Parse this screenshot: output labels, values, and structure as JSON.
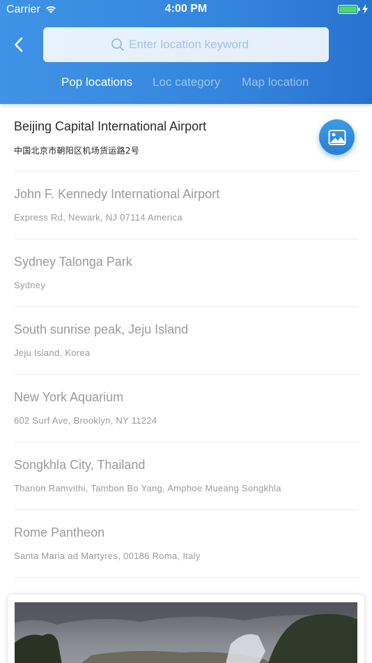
{
  "status_bar": {
    "carrier": "Carrier",
    "time": "4:00 PM",
    "icons": [
      "wifi-icon",
      "battery-icon",
      "charging-bolt-icon"
    ],
    "battery_color": "#4cd964"
  },
  "header": {
    "back_icon": "chevron-left-icon",
    "search": {
      "icon": "search-icon",
      "placeholder": "Enter location keyword",
      "value": ""
    },
    "tabs": [
      {
        "label": "Pop locations",
        "active": true
      },
      {
        "label": "Loc category",
        "active": false
      },
      {
        "label": "Map location",
        "active": false
      }
    ],
    "gradient_colors": [
      "#3f93e6",
      "#2872cf"
    ]
  },
  "locations": [
    {
      "title": "Beijing Capital International Airport",
      "subtitle": "中国北京市朝阳区机场货运路2号"
    },
    {
      "title": "John F. Kennedy International Airport",
      "subtitle": "Express Rd, Newark, NJ 07114 America"
    },
    {
      "title": "Sydney Talonga Park",
      "subtitle": "Sydney"
    },
    {
      "title": "South sunrise peak, Jeju Island",
      "subtitle": "Jeju Island, Korea"
    },
    {
      "title": "New York Aquarium",
      "subtitle": "602 Surf Ave, Brooklyn, NY 11224"
    },
    {
      "title": "Songkhla City, Thailand",
      "subtitle": "Thanon Ramvithi, Tambon Bo Yang, Amphoe Mueang Songkhla"
    },
    {
      "title": "Rome Pantheon",
      "subtitle": "Santa Maria ad Martyres, 00186 Roma, Italy"
    }
  ],
  "fab": {
    "icon": "image-icon",
    "color": "#2f89dc"
  },
  "preview": {
    "image": "waterfall-landscape-photo"
  }
}
